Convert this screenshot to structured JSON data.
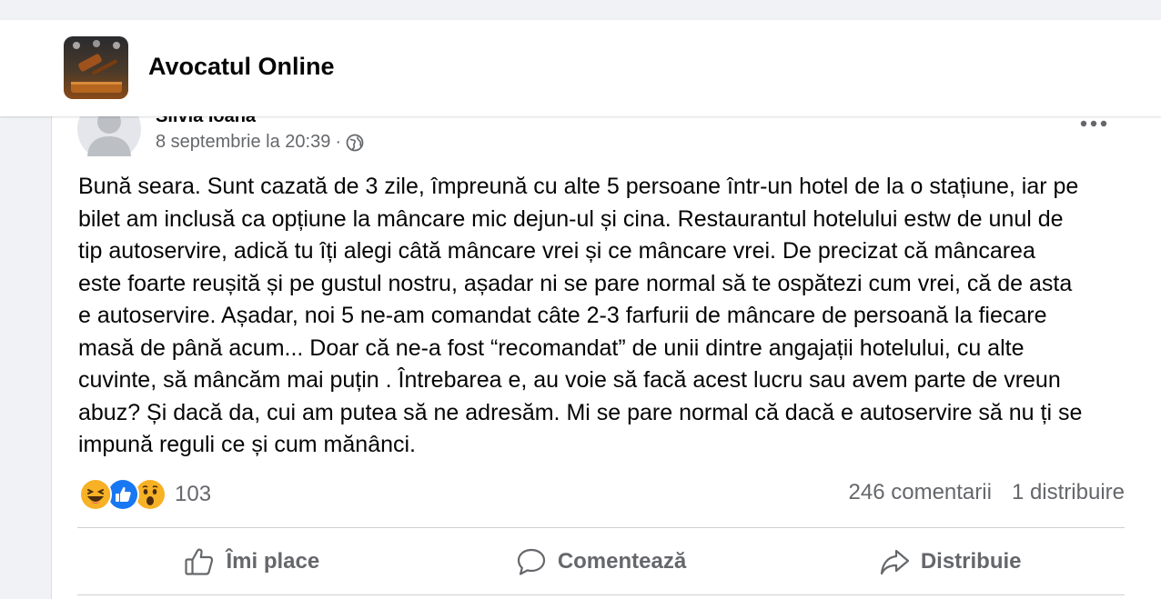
{
  "group": {
    "name": "Avocatul Online"
  },
  "post": {
    "author": "Silvia Ioana",
    "date": "8 septembrie la 20:39",
    "separator": "·",
    "privacy_icon": "globe-icon",
    "text_lines": [
      "Bună seara. Sunt cazată de 3 zile, împreună cu alte 5 persoane într-un hotel de la o stațiune, iar pe",
      "bilet am inclusă ca opțiune la mâncare mic dejun-ul și cina. Restaurantul hotelului estw de unul de",
      "tip autoservire, adică tu îți alegi câtă mâncare vrei și ce mâncare vrei. De precizat că mâncarea",
      "este foarte reușită și pe gustul nostru, așadar ni se pare normal să te ospătezi cum vrei, că de asta",
      "e autoservire. Așadar, noi 5 ne-am comandat câte 2-3 farfurii de mâncare de persoană la fiecare",
      "masă de până acum... Doar că ne-a fost “recomandat” de unii dintre angajații hotelului, cu alte",
      "cuvinte, să mâncăm mai puțin . Întrebarea e, au voie să facă acest lucru sau avem parte de vreun",
      "abuz? Și dacă da, cui am putea să ne adresăm. Mi se pare normal că dacă e autoservire să nu ți se",
      "impună reguli ce și cum mănânci."
    ]
  },
  "reactions": {
    "icons": [
      "haha-icon",
      "like-icon",
      "wow-icon"
    ],
    "count": "103"
  },
  "stats": {
    "comments": "246 comentarii",
    "shares": "1 distribuire"
  },
  "actions": {
    "like": "Îmi place",
    "comment": "Comentează",
    "share": "Distribuie"
  },
  "colors": {
    "like_blue": "#1877f2",
    "reaction_yellow": "#f7b125",
    "secondary_text": "#65676b"
  }
}
